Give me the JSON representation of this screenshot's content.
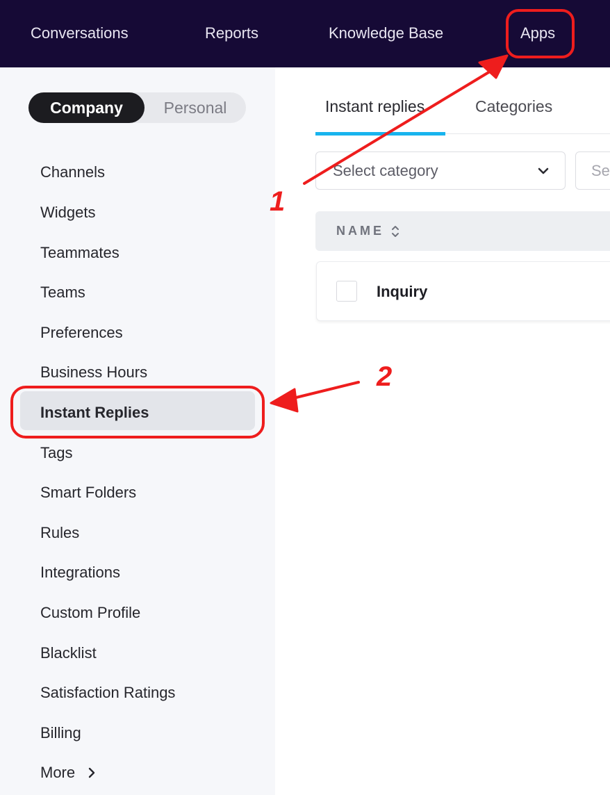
{
  "topnav": {
    "items": [
      "Conversations",
      "Reports",
      "Knowledge Base",
      "Apps"
    ]
  },
  "sidebar": {
    "scope_toggle": {
      "active": "Company",
      "inactive": "Personal"
    },
    "items": [
      "Channels",
      "Widgets",
      "Teammates",
      "Teams",
      "Preferences",
      "Business Hours",
      "Instant Replies",
      "Tags",
      "Smart Folders",
      "Rules",
      "Integrations",
      "Custom Profile",
      "Blacklist",
      "Satisfaction Ratings",
      "Billing",
      "More"
    ],
    "selected": "Instant Replies"
  },
  "main": {
    "tabs": [
      "Instant replies",
      "Categories"
    ],
    "active_tab": "Instant replies",
    "category_select": {
      "value": "Select category"
    },
    "search": {
      "placeholder": "Se"
    },
    "table": {
      "header": "NAME",
      "rows": [
        {
          "name": "Inquiry"
        }
      ]
    }
  },
  "annotations": {
    "step1": "1",
    "step2": "2",
    "color": "#ee1d1d"
  },
  "colors": {
    "topnav_bg": "#160a36",
    "tab_accent": "#18b4ee",
    "sidebar_bg": "#f6f7fa"
  }
}
